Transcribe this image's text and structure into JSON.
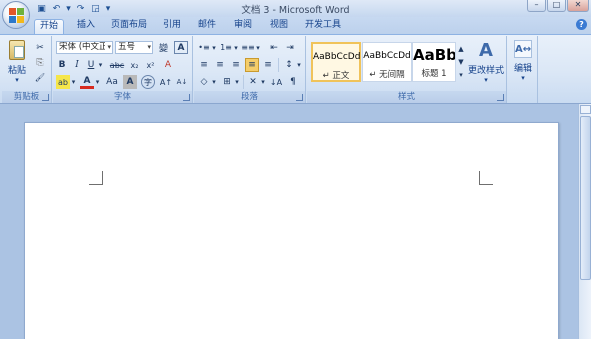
{
  "window": {
    "title": "文档 3 - Microsoft Word",
    "minimize": "–",
    "maximize": "□",
    "close": "✕"
  },
  "qat": {
    "save": "▣",
    "undo": "↶",
    "undo_dd": "▾",
    "redo": "↷",
    "print_preview": "◲",
    "customize": "▾"
  },
  "tabs": [
    "开始",
    "插入",
    "页面布局",
    "引用",
    "邮件",
    "审阅",
    "视图",
    "开发工具"
  ],
  "help": "?",
  "groups": {
    "clipboard": {
      "label": "剪贴板",
      "paste": "粘贴",
      "cut": "✂",
      "copy": "⎘",
      "format_painter": "🖌"
    },
    "font": {
      "label": "字体",
      "font_name": "宋体 (中文正文)",
      "font_size": "五号",
      "phonetic": "變",
      "char_border": "A",
      "bold": "B",
      "italic": "I",
      "underline": "U",
      "strike": "abc",
      "subscript": "x₂",
      "superscript": "x²",
      "clear": "A",
      "highlight": "ab",
      "font_color": "A",
      "change_case": "Aa",
      "char_shading": "A",
      "enclose": "字",
      "grow": "A↑",
      "shrink": "A↓"
    },
    "paragraph": {
      "label": "段落",
      "bullets": "•≡",
      "numbering": "1≡",
      "multilevel": "≡≡",
      "decrease_indent": "⇤",
      "increase_indent": "⇥",
      "align_left": "≡",
      "center": "≡",
      "align_right": "≡",
      "justify": "≡",
      "distributed": "≡",
      "line_spacing": "↕",
      "shading": "◇",
      "borders": "⊞",
      "chinese_layout": "✕",
      "sort": "↓A",
      "show_marks": "¶"
    },
    "styles": {
      "label": "样式",
      "cards": [
        {
          "preview": "AaBbCcDd",
          "name": "↵ 正文"
        },
        {
          "preview": "AaBbCcDd",
          "name": "↵ 无间隔"
        },
        {
          "preview": "AaBb",
          "name": "标题 1"
        }
      ],
      "change_styles": "更改样式"
    },
    "editing": {
      "label": "编辑"
    }
  },
  "colors": {
    "highlight": "#f5e64b",
    "font_color": "#d62a1f",
    "accent": "#15428b"
  }
}
